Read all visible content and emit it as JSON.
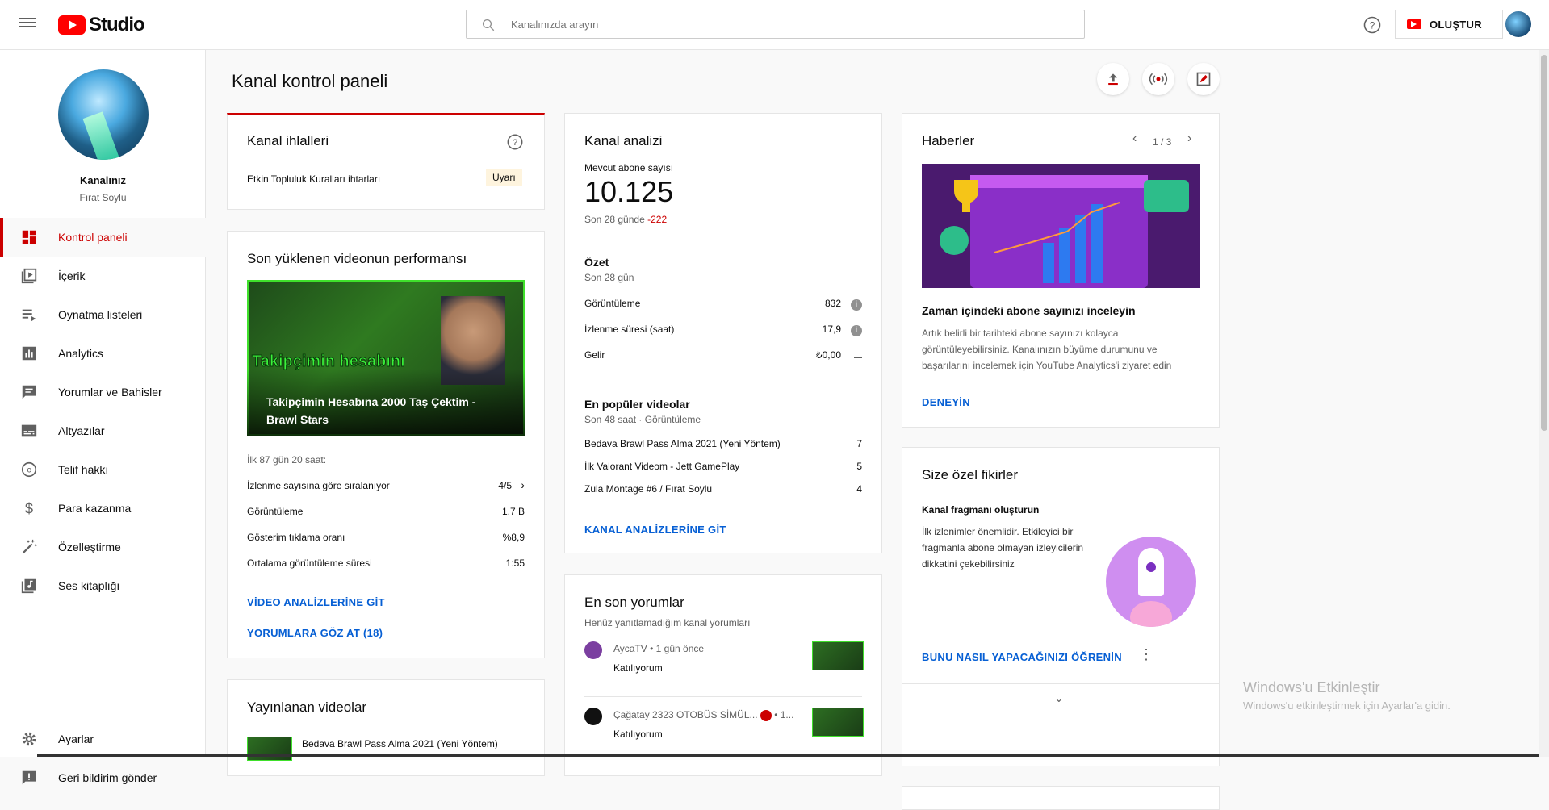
{
  "header": {
    "logo_text": "Studio",
    "search_placeholder": "Kanalınızda arayın",
    "create_label": "OLUŞTUR"
  },
  "sidebar": {
    "channel_label": "Kanalınız",
    "channel_name": "Fırat Soylu",
    "items": [
      {
        "label": "Kontrol paneli",
        "icon": "dashboard-icon",
        "active": true
      },
      {
        "label": "İçerik",
        "icon": "content-icon"
      },
      {
        "label": "Oynatma listeleri",
        "icon": "playlists-icon"
      },
      {
        "label": "Analytics",
        "icon": "analytics-icon"
      },
      {
        "label": "Yorumlar ve Bahisler",
        "icon": "comments-icon"
      },
      {
        "label": "Altyazılar",
        "icon": "subtitles-icon"
      },
      {
        "label": "Telif hakkı",
        "icon": "copyright-icon"
      },
      {
        "label": "Para kazanma",
        "icon": "dollar-icon"
      },
      {
        "label": "Özelleştirme",
        "icon": "magic-wand-icon"
      },
      {
        "label": "Ses kitaplığı",
        "icon": "audio-library-icon"
      }
    ],
    "bottom_items": [
      {
        "label": "Ayarlar",
        "icon": "gear-icon"
      },
      {
        "label": "Geri bildirim gönder",
        "icon": "feedback-icon"
      }
    ]
  },
  "main": {
    "page_title": "Kanal kontrol paneli",
    "violations": {
      "title": "Kanal ihlalleri",
      "row_label": "Etkin Topluluk Kuralları ihtarları",
      "badge": "Uyarı"
    },
    "latest_video": {
      "title": "Son yüklenen videonun performansı",
      "video_title": "Takipçimin Hesabına 2000 Taş Çektim - Brawl Stars",
      "thumb_overlay_text": "Takipçimin hesabını",
      "period": "İlk 87 gün 20 saat:",
      "rows": [
        {
          "label": "İzlenme sayısına göre sıralanıyor",
          "value": "4/5"
        },
        {
          "label": "Görüntüleme",
          "value": "1,7 B"
        },
        {
          "label": "Gösterim tıklama oranı",
          "value": "%8,9"
        },
        {
          "label": "Ortalama görüntüleme süresi",
          "value": "1:55"
        }
      ],
      "link1": "VİDEO ANALİZLERİNE GİT",
      "link2": "YORUMLARA GÖZ AT (18)"
    },
    "published": {
      "title": "Yayınlanan videolar",
      "first_video": "Bedava Brawl Pass Alma 2021 (Yeni Yöntem)"
    },
    "analytics": {
      "title": "Kanal analizi",
      "subs_label": "Mevcut abone sayısı",
      "subs_count": "10.125",
      "subs_change_label": "Son 28 günde",
      "subs_change": "-222",
      "summary_title": "Özet",
      "summary_period": "Son 28 gün",
      "summary_rows": [
        {
          "label": "Görüntüleme",
          "value": "832"
        },
        {
          "label": "İzlenme süresi (saat)",
          "value": "17,9"
        },
        {
          "label": "Gelir",
          "value": "₺0,00"
        }
      ],
      "top_title": "En popüler videolar",
      "top_period": "Son 48 saat · Görüntüleme",
      "top_videos": [
        {
          "title": "Bedava Brawl Pass Alma 2021 (Yeni Yöntem)",
          "views": "7"
        },
        {
          "title": "İlk Valorant Videom - Jett GamePlay",
          "views": "5"
        },
        {
          "title": "Zula Montage #6 / Fırat Soylu",
          "views": "4"
        }
      ],
      "link": "KANAL ANALİZLERİNE GİT"
    },
    "comments": {
      "title": "En son yorumlar",
      "subtitle": "Henüz yanıtlamadığım kanal yorumları",
      "items": [
        {
          "author": "AycaTV",
          "time": "1 gün önce",
          "text": "Katılıyorum"
        },
        {
          "author": "Çağatay 2323 OTOBÜS SİMÜL...",
          "time": "1...",
          "text": "Katılıyorum"
        }
      ]
    },
    "news": {
      "title": "Haberler",
      "pager": "1 / 3",
      "headline": "Zaman içindeki abone sayınızı inceleyin",
      "body": "Artık belirli bir tarihteki abone sayınızı kolayca görüntüleyebilirsiniz. Kanalınızın büyüme durumunu ve başarılarını incelemek için YouTube Analytics'i ziyaret edin",
      "link": "DENEYİN"
    },
    "ideas": {
      "title": "Size özel fikirler",
      "subtitle": "Kanal fragmanı oluşturun",
      "body": "İlk izlenimler önemlidir. Etkileyici bir fragmanla abone olmayan izleyicilerin dikkatini çekebilirsiniz",
      "link": "BUNU NASIL YAPACAĞINIZI ÖĞRENİN"
    }
  },
  "watermark": {
    "title": "Windows'u Etkinleştir",
    "subtitle": "Windows'u etkinleştirmek için Ayarlar'a gidin."
  },
  "colors": {
    "accent_red": "#cc0000",
    "link_blue": "#065fd4",
    "negative": "#cc0000"
  }
}
